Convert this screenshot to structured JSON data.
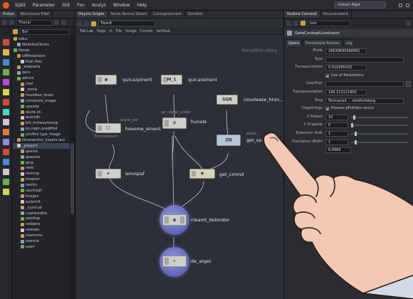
{
  "app": {
    "menu": [
      "Själit",
      "Parameter",
      "Sliit",
      "Fon",
      "Analys",
      "Window",
      "Help"
    ],
    "desktop_label": "Iniceri Aipe"
  },
  "left_panel": {
    "tabs": [
      "Proluo",
      "Worschave Fillet"
    ],
    "path": "Thonal",
    "path2": "Bof",
    "tree": [
      "siduc",
      "  ModeliesDiores",
      "Nelsie",
      "  UlMmdotsion",
      "    Ptah files",
      "  _wiepoeta",
      "  dero",
      "  aenios",
      "    /ixel",
      "    _tomis",
      "    houdikeo_teses",
      "    compoule_image",
      "    upaoda",
      "    ducte.sh",
      "    wrectdir",
      "    biit_kvitwaytomop",
      "    ko.cogin prediflod",
      "    uncfine  lype_image",
      "  Omonection_kayers.lact",
      "  _playjert",
      "    qeeme",
      "    geeeme",
      "    qma",
      "    reeti",
      "    reoinng",
      "    livepost",
      "    nenito",
      "    nevrhoat",
      "    images",
      "    eullertilt",
      "    _nunrcuil",
      "    cuaheieditis",
      "    ooniltap",
      "    sedaere",
      "    newsen",
      "    newmnto",
      "    neernie",
      "    oaerr"
    ]
  },
  "network": {
    "tabs": [
      "Pleyors Grigde",
      "Novie Numse Sloore",
      "Contagnesment",
      "Dorobile"
    ],
    "path": "Tibar8",
    "menu": [
      "Tab Lab",
      "Page",
      "in",
      "File",
      "Image",
      "Cvnoet",
      "Iontfout"
    ],
    "context_label": "houdini-skey",
    "nodes": {
      "n1": {
        "label": "quicazpinent",
        "icon": "◉"
      },
      "n2": {
        "label": "quicassinent",
        "icon": "M_1"
      },
      "n3": {
        "label": "noveleate_hton...",
        "icon": "SQR"
      },
      "n4": {
        "label": "hsoome_einent",
        "sub1": "ucane_paf",
        "sub2": "Trooneranum",
        "icon": "☐"
      },
      "n5": {
        "label": "hunale",
        "sub1": "up_clgmd_junkin",
        "icon": "⚙"
      },
      "n6": {
        "label": "get_sa...",
        "sub1": "poolo...",
        "icon": "ZN"
      },
      "n7": {
        "label": "wnvspaf",
        "icon": "✦"
      },
      "n8": {
        "label": "get_cmmd",
        "icon": "✱"
      },
      "n9": {
        "label": "cleamt_delondor",
        "icon": "◉"
      },
      "n10": {
        "label": "de_arget",
        "icon": "⌐"
      }
    }
  },
  "params_panel": {
    "tabs": [
      "Nodline Conrend",
      "Houcoauteent"
    ],
    "path": "tost",
    "node_title": "GeteContoptLiveInsect",
    "ptabs": [
      "Genra",
      "Previeleple Rorotot",
      "Log"
    ],
    "rows": [
      {
        "type": "field",
        "label": "Mode",
        "value": "18639690068081"
      },
      {
        "type": "field",
        "label": "Typo",
        "value": ""
      },
      {
        "type": "field",
        "label": "Transpecization",
        "value": "0.019265425"
      },
      {
        "type": "check",
        "label": "",
        "value": "Use of Parameters",
        "checked": true
      },
      {
        "type": "field",
        "label": "Lloerfiser",
        "value": ""
      },
      {
        "type": "field",
        "label": "Transparentation",
        "value": "196.213111800"
      },
      {
        "type": "field",
        "label": "Taeg",
        "value": "Tocmaned ... roodhchdong"
      },
      {
        "type": "check",
        "label": "Drgestrings",
        "value": "Precess pFnitilion ansce",
        "checked": true
      },
      {
        "type": "slider",
        "label": "X Freiant",
        "value": "10",
        "level": 0.04
      },
      {
        "type": "slider",
        "label": "X Dragoda",
        "value": "0",
        "level": 0.0
      },
      {
        "type": "slider",
        "label": "Extension Widt",
        "value": "1",
        "level": 0.06
      },
      {
        "type": "slider",
        "label": "Transiation Width",
        "value": "1",
        "level": 0.06
      },
      {
        "type": "field",
        "label": "",
        "value": "0.0666"
      }
    ]
  }
}
